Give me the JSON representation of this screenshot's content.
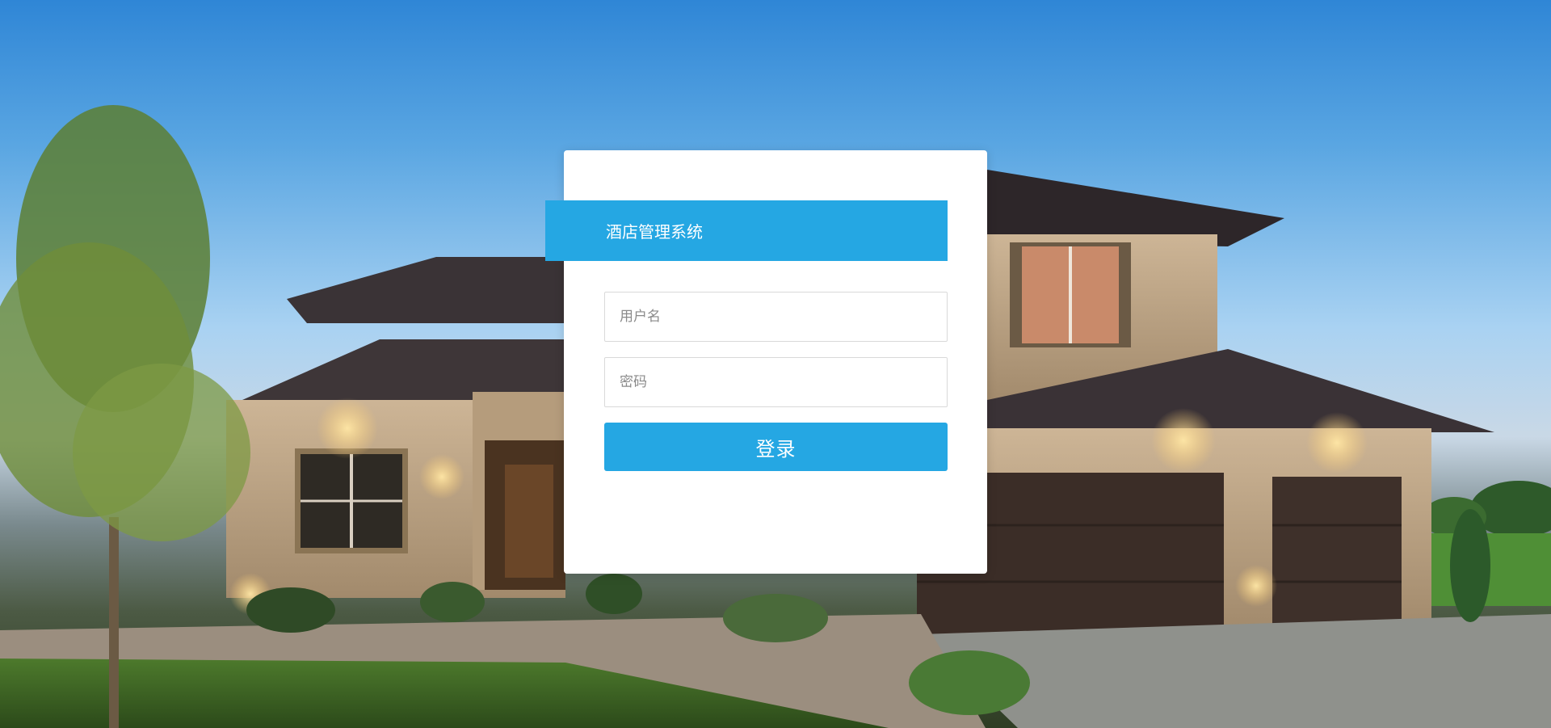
{
  "login": {
    "title": "酒店管理系统",
    "username_placeholder": "用户名",
    "password_placeholder": "密码",
    "submit_label": "登录"
  },
  "colors": {
    "accent": "#25a7e3",
    "card": "#ffffff"
  },
  "background": {
    "image": "house-at-dusk-photo"
  }
}
